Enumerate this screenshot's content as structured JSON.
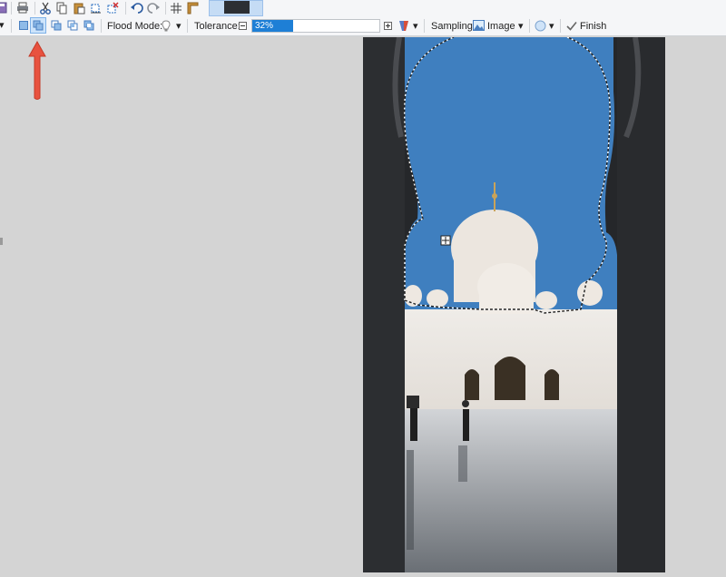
{
  "toolbar": {
    "flood_mode_label": "Flood Mode:",
    "tolerance_label": "Tolerance:",
    "tolerance_value": "32%",
    "tolerance_percent": 32,
    "sampling_label": "Sampling:",
    "sampling_value": "Image",
    "finish_label": "Finish"
  },
  "colors": {
    "accent": "#1e7fd6",
    "arrow": "#e8523f",
    "sky": "#3f7fbf",
    "canvas_bg": "#d4d4d4"
  }
}
